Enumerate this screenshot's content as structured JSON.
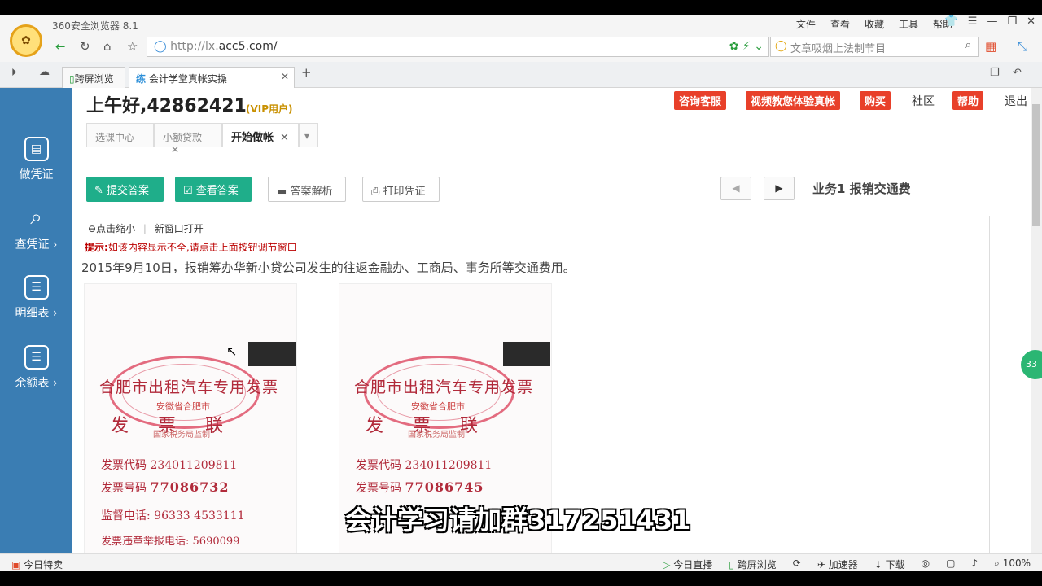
{
  "browser": {
    "title": "360安全浏览器 8.1",
    "menu": [
      "文件",
      "查看",
      "收藏",
      "工具",
      "帮助"
    ],
    "url_prefix": "http://lx.",
    "url_domain": "acc5.com/",
    "search_placeholder": "文章吸烟上法制节目",
    "tabs": [
      {
        "label": "跨屏浏览"
      },
      {
        "label": "会计学堂真帐实操"
      }
    ]
  },
  "sidebar": [
    {
      "label": "做凭证"
    },
    {
      "label": "查凭证 ›"
    },
    {
      "label": "明细表 ›"
    },
    {
      "label": "余额表 ›"
    }
  ],
  "header": {
    "greeting": "上午好,42862421",
    "vip": "(VIP用户)",
    "links": [
      "咨询客服",
      "视频教您体验真帐",
      "购买"
    ],
    "community": "社区",
    "help": "帮助",
    "logout": "退出"
  },
  "inner_tabs": [
    "选课中心",
    "小额贷款",
    "开始做帐"
  ],
  "toolbar": {
    "submit": "提交答案",
    "view": "查看答案",
    "analysis": "答案解析",
    "print": "打印凭证",
    "business": "业务1  报销交通费"
  },
  "panel": {
    "zoom": "点击缩小",
    "new_window": "新窗口打开",
    "hint_label": "提示:",
    "hint_text": "如该内容显示不全,请点击上面按钮调节窗口",
    "description": "2015年9月10日，报销筹办华新小贷公司发生的往返金融办、工商局、事务所等交通费用。"
  },
  "invoices": [
    {
      "title": "合肥市出租汽车专用发票",
      "region": "安徽省合肥市",
      "copy": "发票联",
      "bureau": "国家税务局监制",
      "code_label": "发票代码",
      "code": "234011209811",
      "number_label": "发票号码",
      "number": "77086732",
      "phone_label": "监督电话:",
      "phone": "96333  4533111",
      "report_label": "发票违章举报电话:",
      "report": "5690099"
    },
    {
      "title": "合肥市出租汽车专用发票",
      "region": "安徽省合肥市",
      "copy": "发票联",
      "bureau": "国家税务局监制",
      "code_label": "发票代码",
      "code": "234011209811",
      "number_label": "发票号码",
      "number": "77086745"
    }
  ],
  "overlay_subtitle": "会计学习请加群317251431",
  "status": {
    "left": "今日特卖",
    "right": [
      "今日直播",
      "跨屏浏览",
      "加速器",
      "下载",
      "100%"
    ]
  },
  "colors": {
    "sidebar": "#3a7db3",
    "green_btn": "#1fae8a",
    "red_btn": "#e8402a"
  }
}
